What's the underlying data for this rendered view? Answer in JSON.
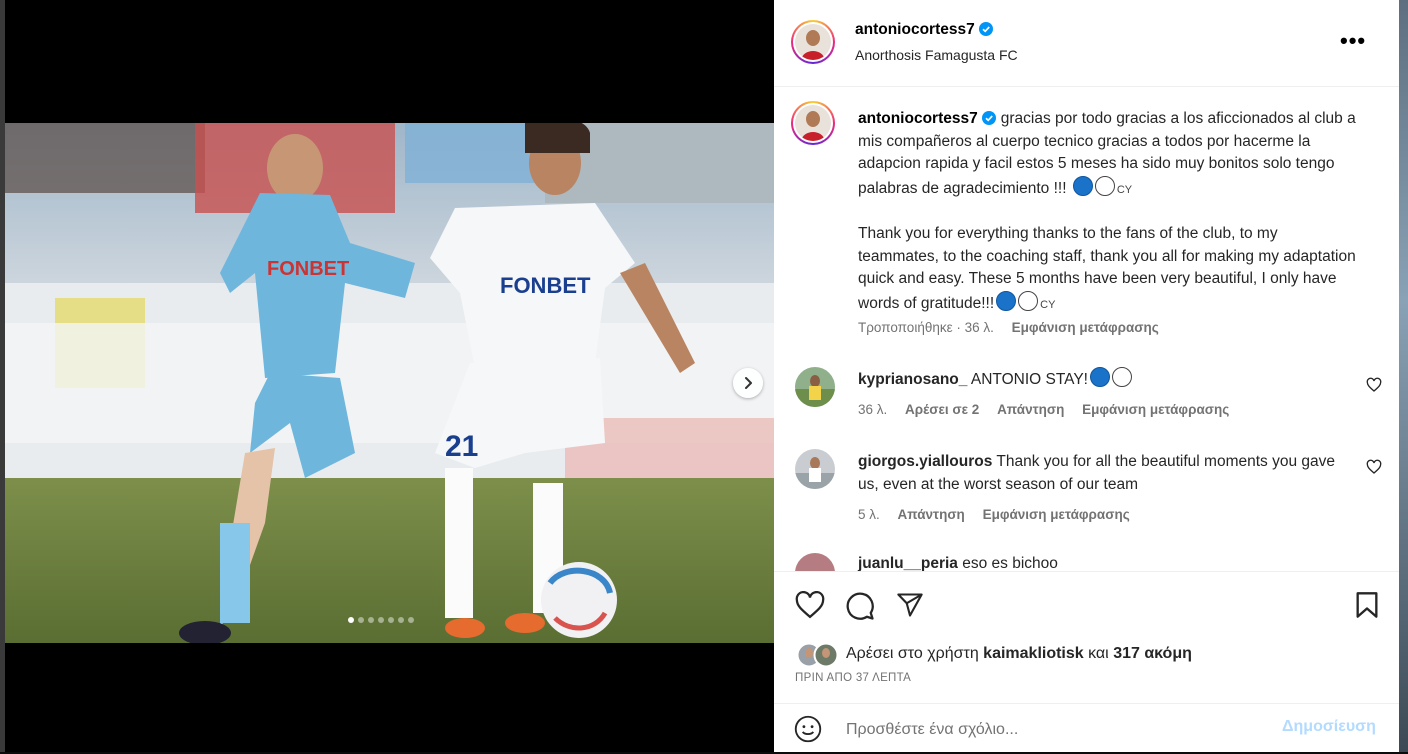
{
  "post": {
    "username": "antoniocortess7",
    "location": "Anorthosis Famagusta FC",
    "caption_es": "gracias por todo gracias a los aficcionados al club a mis compañeros al cuerpo tecnico gracias a todos por hacerme la adapcion rapida y facil estos 5 meses ha sido muy bonitos solo tengo palabras de agradecimiento !!! ",
    "caption_en": "Thank you for everything thanks to the fans of the club, to my teammates, to the coaching staff, thank you all for making my adaptation quick and easy. These 5 months have been very beautiful, I only have words of gratitude!!!",
    "flag_suffix": "CY",
    "caption_meta": "Τροποποιήθηκε · 36 λ.",
    "see_translation": "Εμφάνιση μετάφρασης",
    "carousel": {
      "total": 7,
      "active": 1
    }
  },
  "comments": [
    {
      "username": "kyprianosano_",
      "text": "ANTONIO STAY!",
      "time": "36 λ.",
      "likes": "Αρέσει σε 2",
      "reply": "Απάντηση",
      "translate": "Εμφάνιση μετάφρασης"
    },
    {
      "username": "giorgos.yiallouros",
      "text": "Thank you for all the beautiful moments you gave us, even at the worst season of our team",
      "time": "5 λ.",
      "reply": "Απάντηση",
      "translate": "Εμφάνιση μετάφρασης"
    },
    {
      "username": "juanlu__peria",
      "text": "eso es bichoo"
    }
  ],
  "likes": {
    "prefix": "Αρέσει στο χρήστη",
    "user": "kaimakliotisk",
    "conj": "και",
    "others": "317 ακόμη"
  },
  "timestamp": "ΠΡΙΝ ΑΠΟ 37 ΛΕΠΤΑ",
  "add_comment": {
    "placeholder": "Προσθέστε ένα σχόλιο...",
    "post_label": "Δημοσίευση"
  },
  "icons": [
    "verified-badge-icon",
    "more-options-icon",
    "carousel-next-icon",
    "heart-icon",
    "comment-icon",
    "share-icon",
    "bookmark-icon",
    "emoji-icon"
  ],
  "colors": {
    "verified": "#0095f6",
    "post_disabled": "#b3dbff",
    "secondary_text": "#737373"
  }
}
